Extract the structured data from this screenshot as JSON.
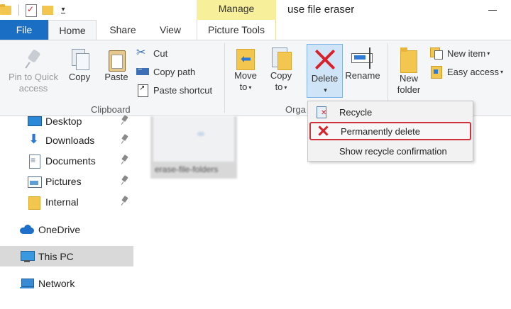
{
  "window": {
    "title": "use file eraser",
    "context_tab_group": "Manage"
  },
  "tabs": [
    {
      "label": "File"
    },
    {
      "label": "Home"
    },
    {
      "label": "Share"
    },
    {
      "label": "View"
    },
    {
      "label": "Picture Tools"
    }
  ],
  "ribbon": {
    "clipboard": {
      "group_label": "Clipboard",
      "pin_to_quick_access_line1": "Pin to Quick",
      "pin_to_quick_access_line2": "access",
      "copy": "Copy",
      "paste": "Paste",
      "cut": "Cut",
      "copy_path": "Copy path",
      "paste_shortcut": "Paste shortcut"
    },
    "organize": {
      "group_label": "Orga",
      "move_to_line1": "Move",
      "move_to_line2": "to",
      "copy_to_line1": "Copy",
      "copy_to_line2": "to",
      "delete": "Delete",
      "rename": "Rename"
    },
    "new": {
      "new_folder_line1": "New",
      "new_folder_line2": "folder",
      "new_item": "New item",
      "easy_access": "Easy access"
    },
    "caret": "▾"
  },
  "delete_menu": {
    "items": [
      {
        "label": "Recycle",
        "icon": "recycle-bin-icon"
      },
      {
        "label": "Permanently delete",
        "icon": "permanent-delete-icon",
        "highlighted": true
      },
      {
        "label": "Show recycle confirmation"
      }
    ],
    "highlight_color": "#d0313c"
  },
  "nav": {
    "items": [
      {
        "label": "Desktop",
        "icon": "desktop-icon",
        "pinned": true
      },
      {
        "label": "Downloads",
        "icon": "downloads-icon",
        "pinned": true
      },
      {
        "label": "Documents",
        "icon": "documents-icon",
        "pinned": true
      },
      {
        "label": "Pictures",
        "icon": "pictures-icon",
        "pinned": true
      },
      {
        "label": "Internal",
        "icon": "folder-icon",
        "pinned": true
      },
      {
        "label": "OneDrive",
        "icon": "onedrive-icon"
      },
      {
        "label": "This PC",
        "icon": "this-pc-icon",
        "selected": true
      },
      {
        "label": "Network",
        "icon": "network-icon"
      }
    ]
  },
  "content": {
    "file_name": "erase-file-folders"
  },
  "colors": {
    "file_tab": "#1a6fc4",
    "manage_tab": "#f7ef9a",
    "ribbon_bg": "#f5f6f7",
    "delete_pressed": "#cfe4f7",
    "delete_x": "#d9202a",
    "nav_selected": "#d9d9d9"
  }
}
